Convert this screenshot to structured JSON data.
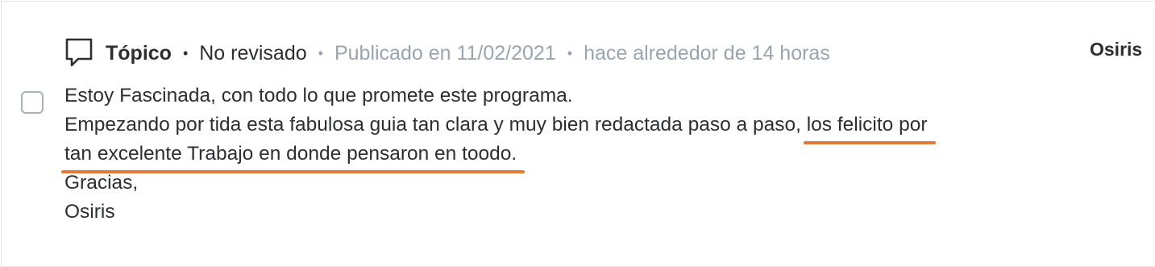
{
  "post": {
    "type_label": "Tópico",
    "status": "No revisado",
    "published": "Publicado en 11/02/2021",
    "relative_time": "hace alrededor de 14 horas",
    "author": "Osiris",
    "body": {
      "line1": "Estoy Fascinada, con todo lo que promete este programa.",
      "line2_plain": "Empezando por tida esta fabulosa guia tan clara y muy bien redactada paso a paso, ",
      "line2_highlight": "los felicito por",
      "line3_highlight": "tan excelente Trabajo en donde pensaron en toodo.",
      "line4": "Gracias,",
      "line5": "Osiris"
    }
  },
  "colors": {
    "highlight_underline": "#e07b39",
    "muted_text": "#98a4b0",
    "text": "#2b2f33"
  },
  "icons": {
    "type_icon": "speech-bubble-icon"
  }
}
